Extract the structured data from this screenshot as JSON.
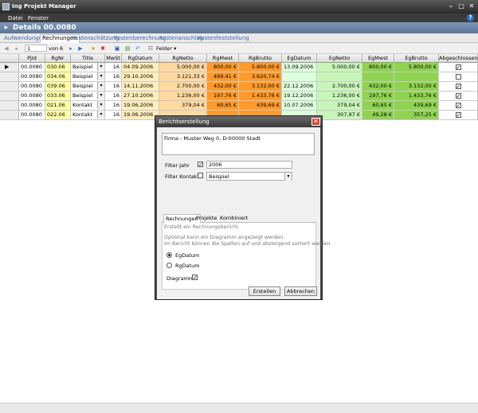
{
  "window": {
    "title": "Ing Projekt Manager"
  },
  "menu": {
    "items": [
      "Datei",
      "Fenster"
    ]
  },
  "detail": {
    "title": "Details 00.0080"
  },
  "tabs": [
    "Aufwendungen",
    "Rechnungen",
    "Kostenschätzung",
    "Kostenberechnung",
    "Kostenanschlag",
    "Kostenfeststellung"
  ],
  "toolbar": {
    "record_value": "1",
    "record_of": "von 6",
    "felder_label": "Felder"
  },
  "grid": {
    "columns": [
      "PjId",
      "RgNr",
      "Title",
      "MwSt",
      "RgDatum",
      "RgNetto",
      "RgMwst",
      "RgBrutto",
      "EgDatum",
      "EgNetto",
      "EgMwst",
      "EgBrutto",
      "Abgeschlossen"
    ],
    "rows": [
      {
        "pjid": "00.0080",
        "rgnr": "030.06",
        "title": "Beispiel",
        "mwst": "16",
        "rgdatum": "04.09.2006",
        "rgnetto": "5.000,00 €",
        "rgmwst": "800,00 €",
        "rgbrutto": "5.800,00 €",
        "egdatum": "13.09.2006",
        "egnetto": "5.000,00 €",
        "egmwst": "800,00 €",
        "egbrutto": "5.800,00 €",
        "done": true
      },
      {
        "pjid": "00.0080",
        "rgnr": "034.06",
        "title": "Beispiel",
        "mwst": "16",
        "rgdatum": "29.10.2006",
        "rgnetto": "3.121,33 €",
        "rgmwst": "499,41 €",
        "rgbrutto": "3.620,74 €",
        "egdatum": "",
        "egnetto": "",
        "egmwst": "",
        "egbrutto": "",
        "done": false
      },
      {
        "pjid": "00.0080",
        "rgnr": "039.06",
        "title": "Beispiel",
        "mwst": "16",
        "rgdatum": "14.11.2006",
        "rgnetto": "2.700,00 €",
        "rgmwst": "432,00 €",
        "rgbrutto": "3.132,00 €",
        "egdatum": "22.12.2006",
        "egnetto": "2.700,00 €",
        "egmwst": "432,00 €",
        "egbrutto": "3.132,00 €",
        "done": true
      },
      {
        "pjid": "00.0080",
        "rgnr": "033.06",
        "title": "Beispiel",
        "mwst": "16",
        "rgdatum": "27.10.2006",
        "rgnetto": "1.236,00 €",
        "rgmwst": "197,76 €",
        "rgbrutto": "1.433,76 €",
        "egdatum": "19.12.2006",
        "egnetto": "1.236,00 €",
        "egmwst": "197,76 €",
        "egbrutto": "1.433,76 €",
        "done": true
      },
      {
        "pjid": "00.0080",
        "rgnr": "021.06",
        "title": "Kontakt",
        "mwst": "16",
        "rgdatum": "19.06.2006",
        "rgnetto": "379,04 €",
        "rgmwst": "60,65 €",
        "rgbrutto": "439,69 €",
        "egdatum": "10.07.2006",
        "egnetto": "379,04 €",
        "egmwst": "60,65 €",
        "egbrutto": "439,69 €",
        "done": true
      },
      {
        "pjid": "00.0080",
        "rgnr": "022.06",
        "title": "Kontakt",
        "mwst": "16",
        "rgdatum": "19.06.2006",
        "rgnetto": "",
        "rgmwst": "",
        "rgbrutto": "",
        "egdatum": "",
        "egnetto": "307,97 €",
        "egmwst": "49,28 €",
        "egbrutto": "357,25 €",
        "done": true
      }
    ]
  },
  "colors": {
    "rgnr_bg": "#ffffa8",
    "rgdatum_bg": "#ffeebb",
    "rgnetto_bg": "#ffd9a0",
    "rgmwst_bg": "#ff9a2a",
    "egdatum_bg": "#ddffdd",
    "egnetto_bg": "#c8f5b8",
    "egmwst_bg": "#8fd450",
    "accent": "#5d7697"
  },
  "dialog": {
    "title": "Berichtserstellung",
    "firma_text": "Firma -  Muster Weg 0, D-00000 Stadt",
    "filter_jahr_label": "Filter Jahr",
    "filter_jahr_value": "2006",
    "filter_kontakt_label": "Filter Kontakt",
    "filter_kontakt_value": "Beispiel",
    "tabs": [
      "Rechnungen",
      "Projekte",
      "Kombiniert"
    ],
    "desc1": "Erstellt ein Rechnungsbericht.",
    "desc2": "Optional kann ein Diagramm angezeigt werden.",
    "desc3": "Im Bericht können die Spalten auf und absteigend sortiert werden.",
    "radio1": "EgDatum",
    "radio2": "RgDatum",
    "diagramm_label": "Diagramm",
    "create_button": "Erstellen",
    "cancel_button": "Abbrechen"
  }
}
